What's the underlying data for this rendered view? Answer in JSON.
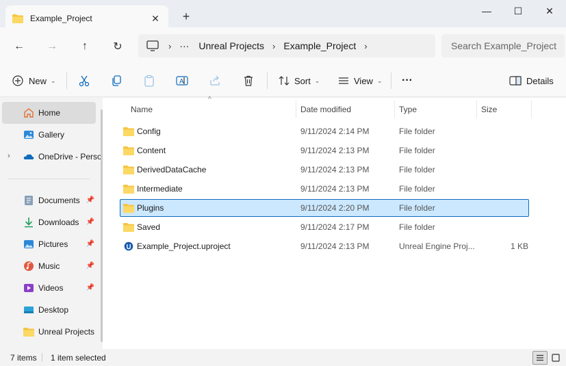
{
  "window": {
    "tab_title": "Example_Project",
    "new_tab": "+",
    "close_tab": "✕",
    "minimize": "—",
    "maximize": "☐",
    "close": "✕"
  },
  "nav": {
    "back": "←",
    "forward": "→",
    "up": "↑",
    "refresh": "↻",
    "breadcrumb": [
      "···",
      "Unreal Projects",
      "Example_Project"
    ],
    "separator": "›",
    "search_placeholder": "Search Example_Project"
  },
  "commands": {
    "new": "New",
    "sort": "Sort",
    "view": "View",
    "more": "···",
    "details": "Details"
  },
  "sidebar": {
    "items": [
      {
        "label": "Home",
        "icon": "home-icon",
        "active": true
      },
      {
        "label": "Gallery",
        "icon": "gallery-icon"
      },
      {
        "label": "OneDrive - Personal",
        "icon": "onedrive-icon"
      },
      {
        "label": "Documents",
        "icon": "documents-icon",
        "pinned": true
      },
      {
        "label": "Downloads",
        "icon": "downloads-icon",
        "pinned": true
      },
      {
        "label": "Pictures",
        "icon": "pictures-icon",
        "pinned": true
      },
      {
        "label": "Music",
        "icon": "music-icon",
        "pinned": true
      },
      {
        "label": "Videos",
        "icon": "videos-icon",
        "pinned": true
      },
      {
        "label": "Desktop",
        "icon": "desktop-icon"
      },
      {
        "label": "Unreal Projects",
        "icon": "folder-icon"
      }
    ]
  },
  "table": {
    "columns": [
      "Name",
      "Date modified",
      "Type",
      "Size"
    ],
    "rows": [
      {
        "name": "Config",
        "date": "9/11/2024 2:14 PM",
        "type": "File folder",
        "size": ""
      },
      {
        "name": "Content",
        "date": "9/11/2024 2:13 PM",
        "type": "File folder",
        "size": ""
      },
      {
        "name": "DerivedDataCache",
        "date": "9/11/2024 2:13 PM",
        "type": "File folder",
        "size": ""
      },
      {
        "name": "Intermediate",
        "date": "9/11/2024 2:13 PM",
        "type": "File folder",
        "size": ""
      },
      {
        "name": "Plugins",
        "date": "9/11/2024 2:20 PM",
        "type": "File folder",
        "size": "",
        "selected": true
      },
      {
        "name": "Saved",
        "date": "9/11/2024 2:17 PM",
        "type": "File folder",
        "size": ""
      },
      {
        "name": "Example_Project.uproject",
        "date": "9/11/2024 2:13 PM",
        "type": "Unreal Engine Proj...",
        "size": "1 KB"
      }
    ]
  },
  "status": {
    "item_count": "7 items",
    "selection": "1 item selected"
  },
  "colors": {
    "folder": "#f5c542",
    "selection_bg": "#cce8ff",
    "selection_border": "#0f6cbd",
    "accent": "#0f6cbd"
  }
}
